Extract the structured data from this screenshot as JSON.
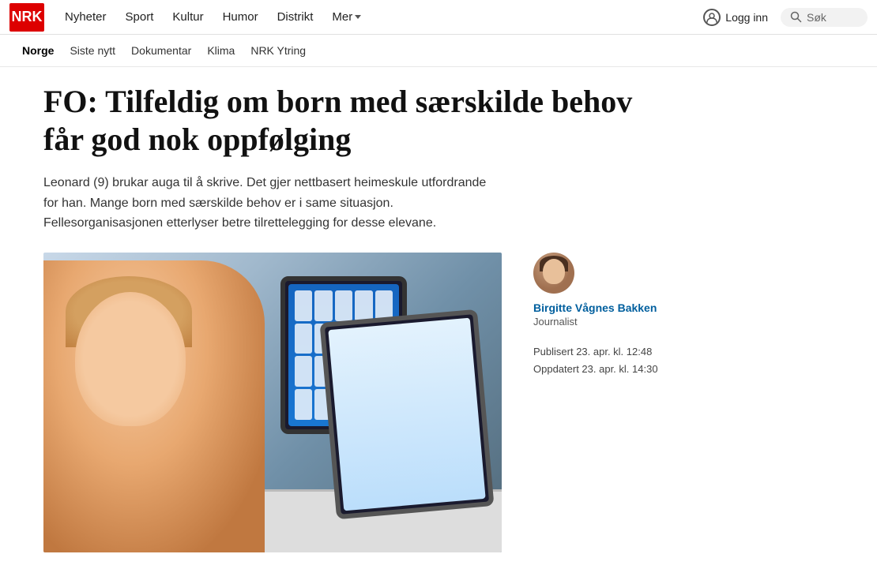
{
  "brand": {
    "logo_text": "NRK",
    "logo_color": "#cc0000"
  },
  "nav": {
    "links": [
      {
        "label": "Nyheter",
        "active": false
      },
      {
        "label": "Sport",
        "active": false
      },
      {
        "label": "Kultur",
        "active": false
      },
      {
        "label": "Humor",
        "active": false
      },
      {
        "label": "Distrikt",
        "active": false
      },
      {
        "label": "Mer",
        "has_dropdown": true
      }
    ],
    "logg_inn_label": "Logg inn",
    "search_placeholder": "Søk"
  },
  "subnav": {
    "links": [
      {
        "label": "Norge",
        "active": true
      },
      {
        "label": "Siste nytt",
        "active": false
      },
      {
        "label": "Dokumentar",
        "active": false
      },
      {
        "label": "Klima",
        "active": false
      },
      {
        "label": "NRK Ytring",
        "active": false
      }
    ]
  },
  "article": {
    "title": "FO: Tilfeldig om born med særskilde behov får god nok oppfølging",
    "lead": "Leonard (9) brukar auga til å skrive. Det gjer nettbasert heimeskule utfordrande for han. Mange born med særskilde behov er i same situasjon. Fellesorganisasjonen etterlyser betre tilrettelegging for desse elevane.",
    "author": {
      "name": "Birgitte Vågnes Bakken",
      "role": "Journalist"
    },
    "published_label": "Publisert 23. apr. kl. 12:48",
    "updated_label": "Oppdatert 23. apr. kl. 14:30"
  }
}
